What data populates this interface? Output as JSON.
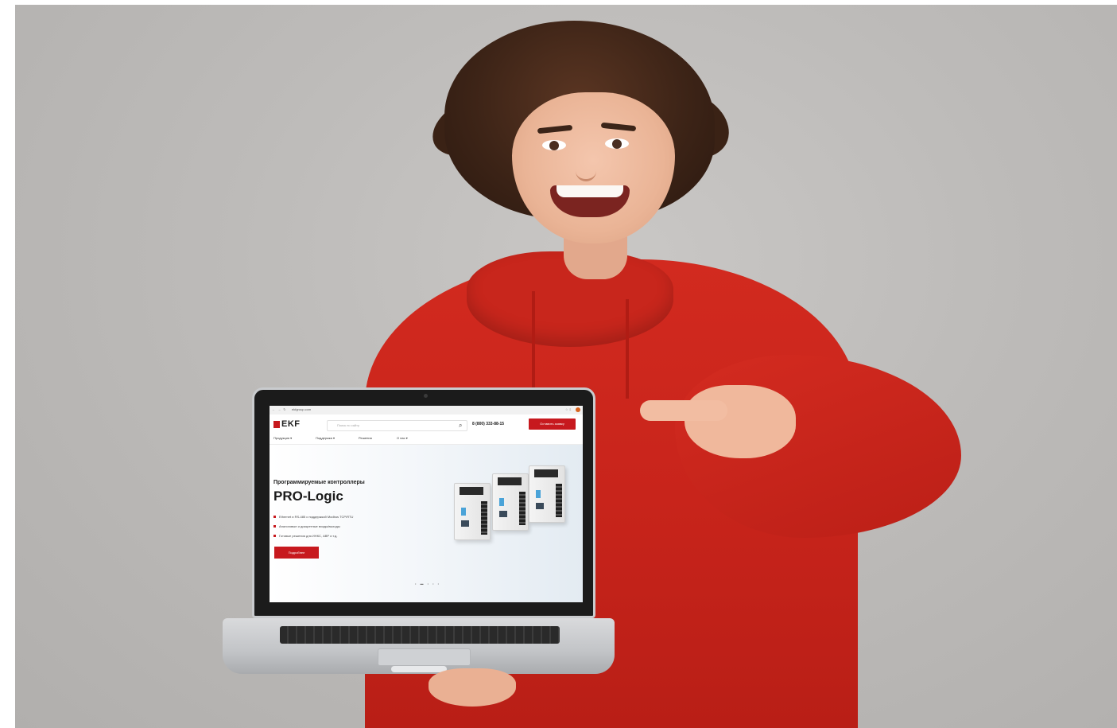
{
  "scene": {
    "colors": {
      "background": "#bdbbb9",
      "hoodie": "#c8241b",
      "brand_red": "#c7191e"
    }
  },
  "browser": {
    "nav_glyphs": "← → ↻",
    "url": "ekfgroup.com",
    "right_icons": "☆ ⇩"
  },
  "site": {
    "logo": "EKF",
    "search_placeholder": "Поиск по сайту",
    "search_icon": "search-icon",
    "phone": "8 (800) 333-88-15",
    "callback_button": "Оставить заявку",
    "nav": [
      "Продукция ▾",
      "Поддержка ▾",
      "Решения",
      "О нас ▾"
    ],
    "hero": {
      "subtitle": "Программируемые контроллеры",
      "title": "PRO-Logic",
      "bullets": [
        "Ethernet и RS-485 с поддержкой Modbus TCP/RTU",
        "Аналоговые и дискретные входы/выходы",
        "Готовые решения для ИНКС, АВР и т.д."
      ],
      "button": "Подробнее",
      "slider_dots": "• ▬ • • •"
    }
  }
}
